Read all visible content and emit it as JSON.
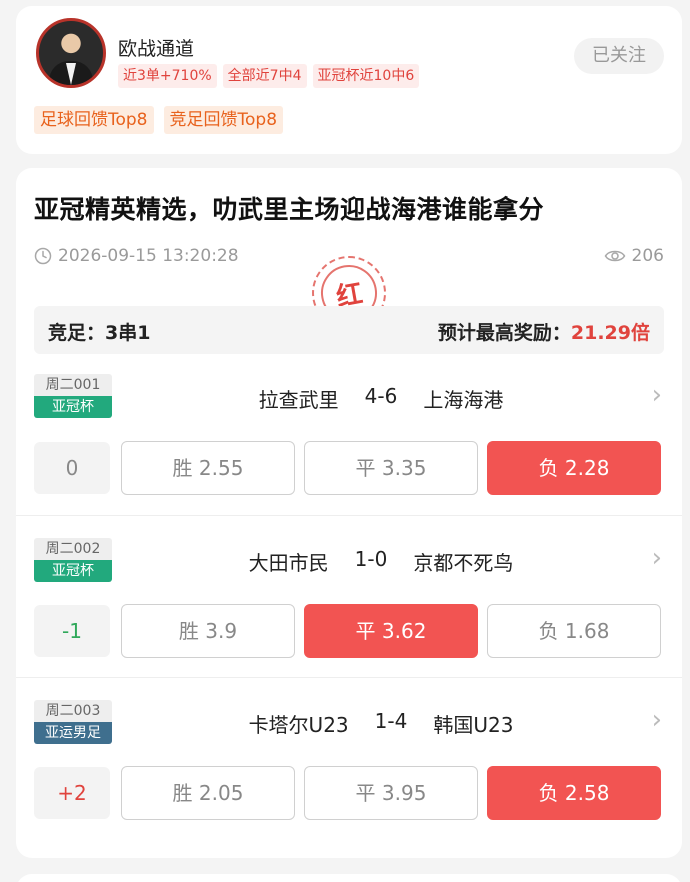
{
  "author": {
    "name": "欧战通道",
    "stats": [
      "近3单+710%",
      "全部近7中4",
      "亚冠杯近10中6"
    ],
    "follow_label": "已关注",
    "ranks": [
      "足球回馈Top8",
      "竞足回馈Top8"
    ]
  },
  "post": {
    "title": "亚冠精英精选，叻武里主场迎战海港谁能拿分",
    "datetime": "2026-09-15 13:20:28",
    "views": "206",
    "stamp": "红",
    "summary": {
      "left": "竞足：3串1",
      "right_label": "预计最高奖励：",
      "right_value": "21.29倍"
    }
  },
  "matches": [
    {
      "day": "周二001",
      "league": "亚冠杯",
      "league_color": "#22a97d",
      "home": "拉查武里",
      "score": "4-6",
      "away": "上海海港",
      "handicap": "0",
      "options": [
        "胜 2.55",
        "平 3.35",
        "负 2.28"
      ],
      "selected": 2
    },
    {
      "day": "周二002",
      "league": "亚冠杯",
      "league_color": "#22a97d",
      "home": "大田市民",
      "score": "1-0",
      "away": "京都不死鸟",
      "handicap": "-1",
      "options": [
        "胜 3.9",
        "平 3.62",
        "负 1.68"
      ],
      "selected": 1
    },
    {
      "day": "周二003",
      "league": "亚运男足",
      "league_color": "#3f6f8e",
      "home": "卡塔尔U23",
      "score": "1-4",
      "away": "韩国U23",
      "handicap": "+2",
      "options": [
        "胜 2.05",
        "平 3.95",
        "负 2.58"
      ],
      "selected": 2
    }
  ],
  "icons": {
    "clock": "clock-icon",
    "eye": "eye-icon",
    "chevron": "chevron-right-icon"
  },
  "colors": {
    "accent_red": "#f25452",
    "handicap_negative": "#2fa85a",
    "handicap_positive": "#e0433d"
  }
}
